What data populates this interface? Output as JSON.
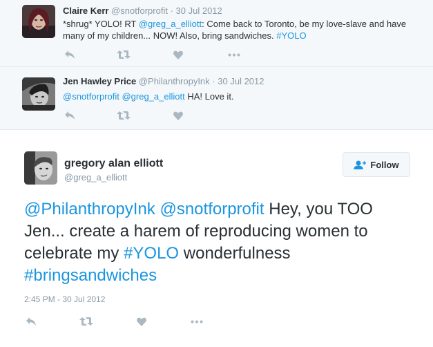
{
  "replies": [
    {
      "name": "Claire Kerr",
      "handle": "@snotforprofit",
      "dot": "·",
      "date": "30 Jul 2012",
      "text_1": "*shrug* YOLO! RT ",
      "mention_1": "@greg_a_elliott",
      "text_2": ": Come back to Toronto, be my love-slave and have many of my children... NOW! Also, bring sandwiches. ",
      "hashtag_1": "#YOLO"
    },
    {
      "name": "Jen Hawley Price",
      "handle": "@PhilanthropyInk",
      "dot": "·",
      "date": "30 Jul 2012",
      "mention_1": "@snotforprofit",
      "mention_2": "@greg_a_elliott",
      "text_1": " HA! Love it."
    }
  ],
  "main_tweet": {
    "name": "gregory alan elliott",
    "handle": "@greg_a_elliott",
    "follow_label": "Follow",
    "mention_1": "@PhilanthropyInk",
    "mention_2": "@snotforprofit",
    "text_1": " Hey, you TOO Jen... create a harem of reproducing women to celebrate my ",
    "hashtag_1": "#YOLO",
    "text_2": " wonderfulness ",
    "hashtag_2": "#bringsandwiches",
    "timestamp": "2:45 PM - 30 Jul 2012"
  },
  "icons": {
    "reply": "reply-icon",
    "retweet": "retweet-icon",
    "like": "heart-icon",
    "more": "more-icon",
    "follow": "add-user-icon"
  },
  "colors": {
    "link": "#1b95e0",
    "muted": "#8899a6",
    "icon": "#aab8c2",
    "reply_bg": "#f5f8fa"
  }
}
